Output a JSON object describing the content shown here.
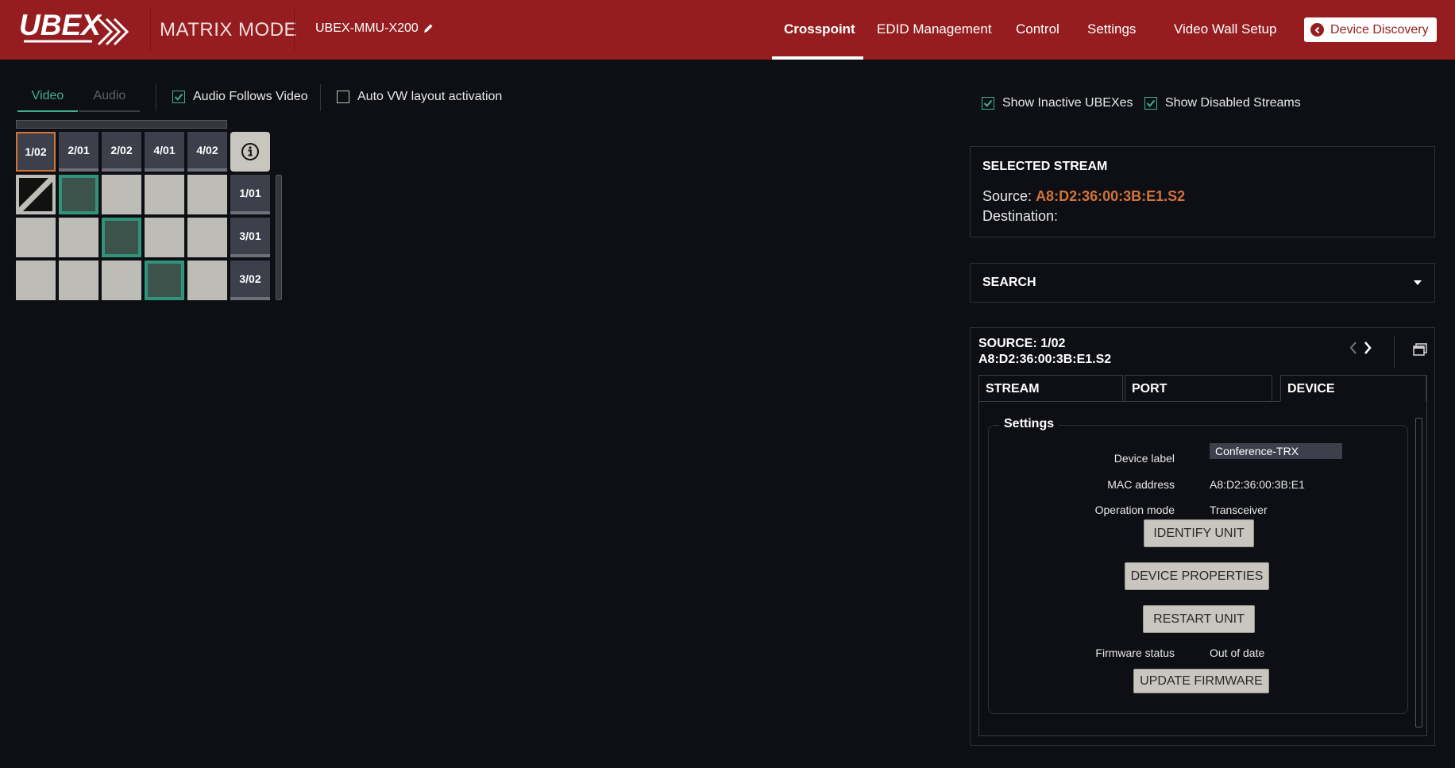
{
  "header": {
    "logo_text": "UBEX",
    "mode": "MATRIX MODE",
    "device_name": "UBEX-MMU-X200",
    "nav": [
      "Crosspoint",
      "EDID Management",
      "Control",
      "Settings",
      "Video Wall Setup"
    ],
    "active_nav": "Crosspoint",
    "discovery_button": "Device Discovery"
  },
  "controls": {
    "tab_video": "Video",
    "tab_audio": "Audio",
    "audio_follows_video": "Audio Follows Video",
    "auto_vw": "Auto VW layout activation",
    "show_inactive": "Show Inactive UBEXes",
    "show_disabled": "Show Disabled Streams"
  },
  "matrix": {
    "sources": [
      "1/02",
      "2/01",
      "2/02",
      "4/01",
      "4/02"
    ],
    "selected_source": "1/02",
    "destinations": [
      "1/01",
      "3/01",
      "3/02"
    ],
    "connections": [
      [
        1
      ],
      [
        2
      ],
      [
        3
      ]
    ],
    "disabled": [
      [
        0
      ]
    ]
  },
  "selected_stream": {
    "title": "SELECTED STREAM",
    "source_label": "Source:",
    "source_value": "A8:D2:36:00:3B:E1.S2",
    "destination_label": "Destination:"
  },
  "search": {
    "title": "SEARCH"
  },
  "source_panel": {
    "title_line1": "SOURCE: 1/02",
    "title_line2": "A8:D2:36:00:3B:E1.S2",
    "tabs": [
      "STREAM",
      "PORT",
      "DEVICE"
    ],
    "active_tab": "DEVICE",
    "settings_title": "Settings",
    "device_label_label": "Device label",
    "device_label_value": "Conference-TRX",
    "mac_label": "MAC address",
    "mac_value": "A8:D2:36:00:3B:E1",
    "opmode_label": "Operation mode",
    "opmode_value": "Transceiver",
    "identify_button": "IDENTIFY UNIT",
    "properties_button": "DEVICE PROPERTIES",
    "restart_button": "RESTART UNIT",
    "firmware_label": "Firmware status",
    "firmware_value": "Out of date",
    "update_button": "UPDATE FIRMWARE"
  },
  "colors": {
    "header_bg": "#951d1f",
    "accent_green": "#3fb28d",
    "accent_orange": "#d2743a"
  }
}
